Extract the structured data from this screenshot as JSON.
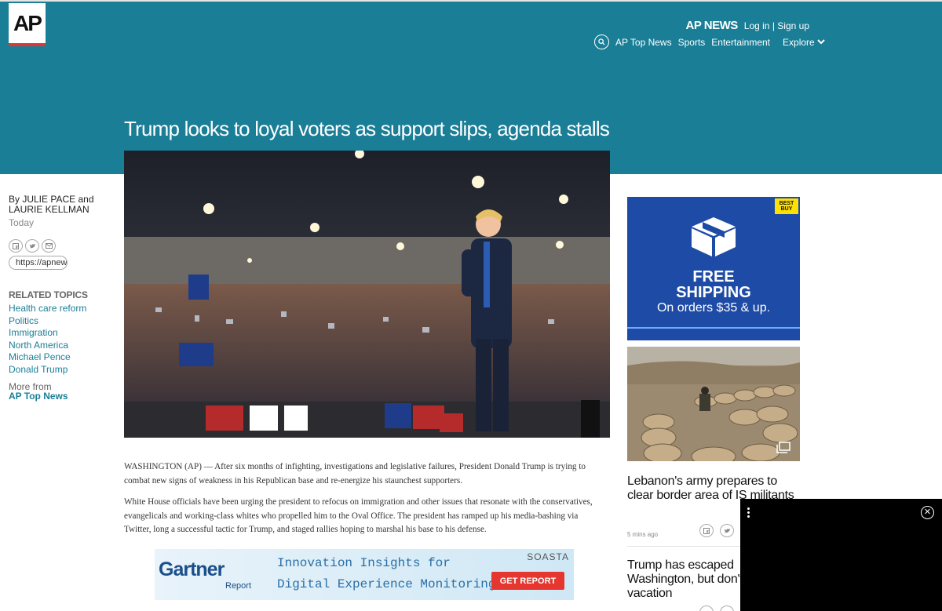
{
  "masthead": {
    "logo": "AP",
    "site_name": "AP NEWS",
    "login": "Log in",
    "separator": "|",
    "signup": "Sign up",
    "nav": [
      "AP Top News",
      "Sports",
      "Entertainment"
    ],
    "explore": "Explore"
  },
  "article": {
    "headline": "Trump looks to loyal voters as support slips, agenda stalls",
    "byline": "By JULIE PACE and LAURIE KELLMAN",
    "date": "Today",
    "share_link": "https://apnews.com",
    "paragraphs": [
      "WASHINGTON (AP) — After six months of infighting, investigations and legislative failures, President Donald Trump is trying to combat new signs of weakness in his Republican base and re-energize his staunchest supporters.",
      "White House officials have been urging the president to refocus on immigration and other issues that resonate with the conservatives, evangelicals and working-class whites who propelled him to the Oval Office. The president has ramped up his media-bashing via Twitter, long a successful tactic for Trump, and staged rallies hoping to marshal his base to his defense."
    ]
  },
  "related": {
    "heading": "RELATED TOPICS",
    "topics": [
      "Health care reform",
      "Politics",
      "Immigration",
      "North America",
      "Michael Pence",
      "Donald Trump"
    ],
    "more_from": "More from",
    "more_link": "AP Top News"
  },
  "banner_ad": {
    "brand": "Gartner",
    "brand_sub": "Report",
    "line1": "Innovation Insights for",
    "line2": "Digital Experience Monitoring",
    "sponsor": "SOASTA",
    "cta": "GET REPORT"
  },
  "side_ad": {
    "logo": "BEST BUY",
    "free": "FREE",
    "shipping": "SHIPPING",
    "orders": "On orders $35 & up."
  },
  "stories": [
    {
      "title": "Lebanon's army prepares to clear border area of IS militants",
      "time": "5 mins ago"
    },
    {
      "title": "Trump has escaped Washington, but don't call it a vacation"
    }
  ],
  "colors": {
    "brand_teal": "#1a7e97",
    "ap_red": "#d73a35",
    "bestbuy_blue": "#1e4ba5",
    "cta_red": "#e5372f"
  },
  "icons": [
    "search-icon",
    "chevron-down-icon",
    "facebook-icon",
    "twitter-icon",
    "email-icon",
    "link-icon",
    "gallery-icon",
    "more-vert-icon",
    "close-icon"
  ]
}
